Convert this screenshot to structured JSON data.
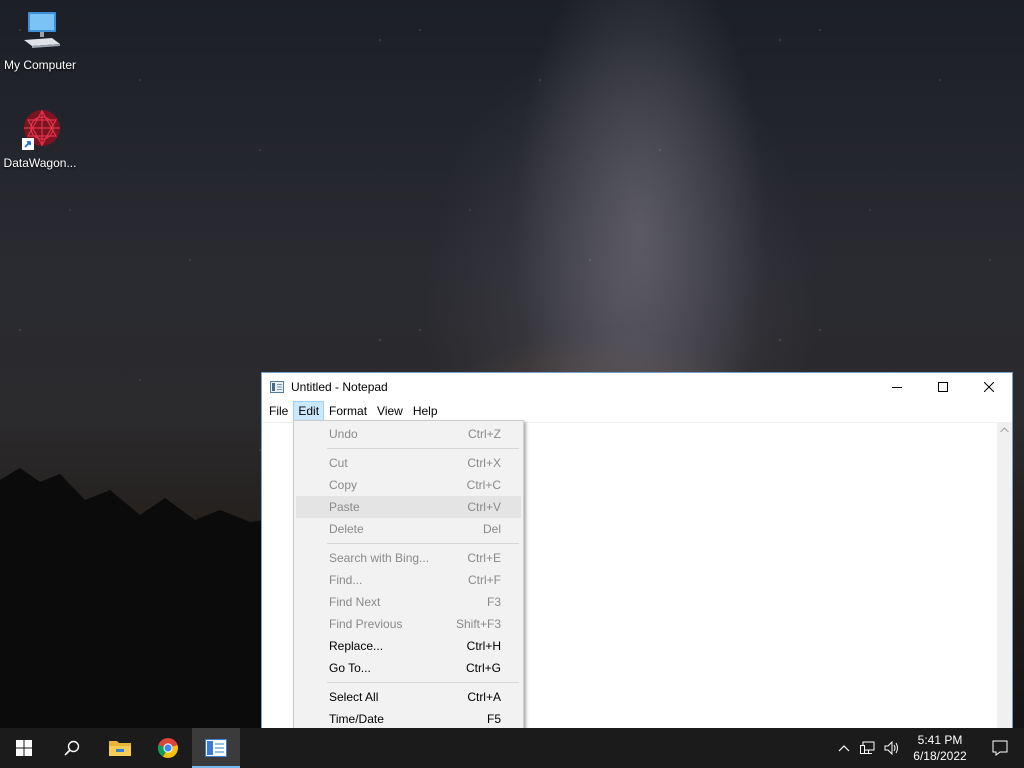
{
  "desktop": {
    "icons": [
      {
        "label": "My Computer",
        "icon": "computer-icon"
      },
      {
        "label": "DataWagon...",
        "icon": "datawagon-icon"
      }
    ]
  },
  "notepad": {
    "title": "Untitled - Notepad",
    "menu": [
      "File",
      "Edit",
      "Format",
      "View",
      "Help"
    ],
    "active_menu": "Edit"
  },
  "edit_menu": {
    "items": [
      {
        "label": "Undo",
        "shortcut": "Ctrl+Z",
        "enabled": false
      },
      {
        "label": "Cut",
        "shortcut": "Ctrl+X",
        "enabled": false
      },
      {
        "label": "Copy",
        "shortcut": "Ctrl+C",
        "enabled": false
      },
      {
        "label": "Paste",
        "shortcut": "Ctrl+V",
        "enabled": false
      },
      {
        "label": "Delete",
        "shortcut": "Del",
        "enabled": false
      },
      {
        "label": "Search with Bing...",
        "shortcut": "Ctrl+E",
        "enabled": false
      },
      {
        "label": "Find...",
        "shortcut": "Ctrl+F",
        "enabled": false
      },
      {
        "label": "Find Next",
        "shortcut": "F3",
        "enabled": false
      },
      {
        "label": "Find Previous",
        "shortcut": "Shift+F3",
        "enabled": false
      },
      {
        "label": "Replace...",
        "shortcut": "Ctrl+H",
        "enabled": true
      },
      {
        "label": "Go To...",
        "shortcut": "Ctrl+G",
        "enabled": true
      },
      {
        "label": "Select All",
        "shortcut": "Ctrl+A",
        "enabled": true
      },
      {
        "label": "Time/Date",
        "shortcut": "F5",
        "enabled": true
      }
    ]
  },
  "taskbar": {
    "apps": [
      "start-icon",
      "search-icon",
      "file-explorer-icon",
      "chrome-icon",
      "notepad-icon"
    ],
    "clock": {
      "time": "5:41 PM",
      "date": "6/18/2022"
    }
  },
  "colors": {
    "taskbar_bg": "#1b1b1b",
    "menu_highlight": "#cce8ff",
    "accent": "#76b9ed"
  }
}
